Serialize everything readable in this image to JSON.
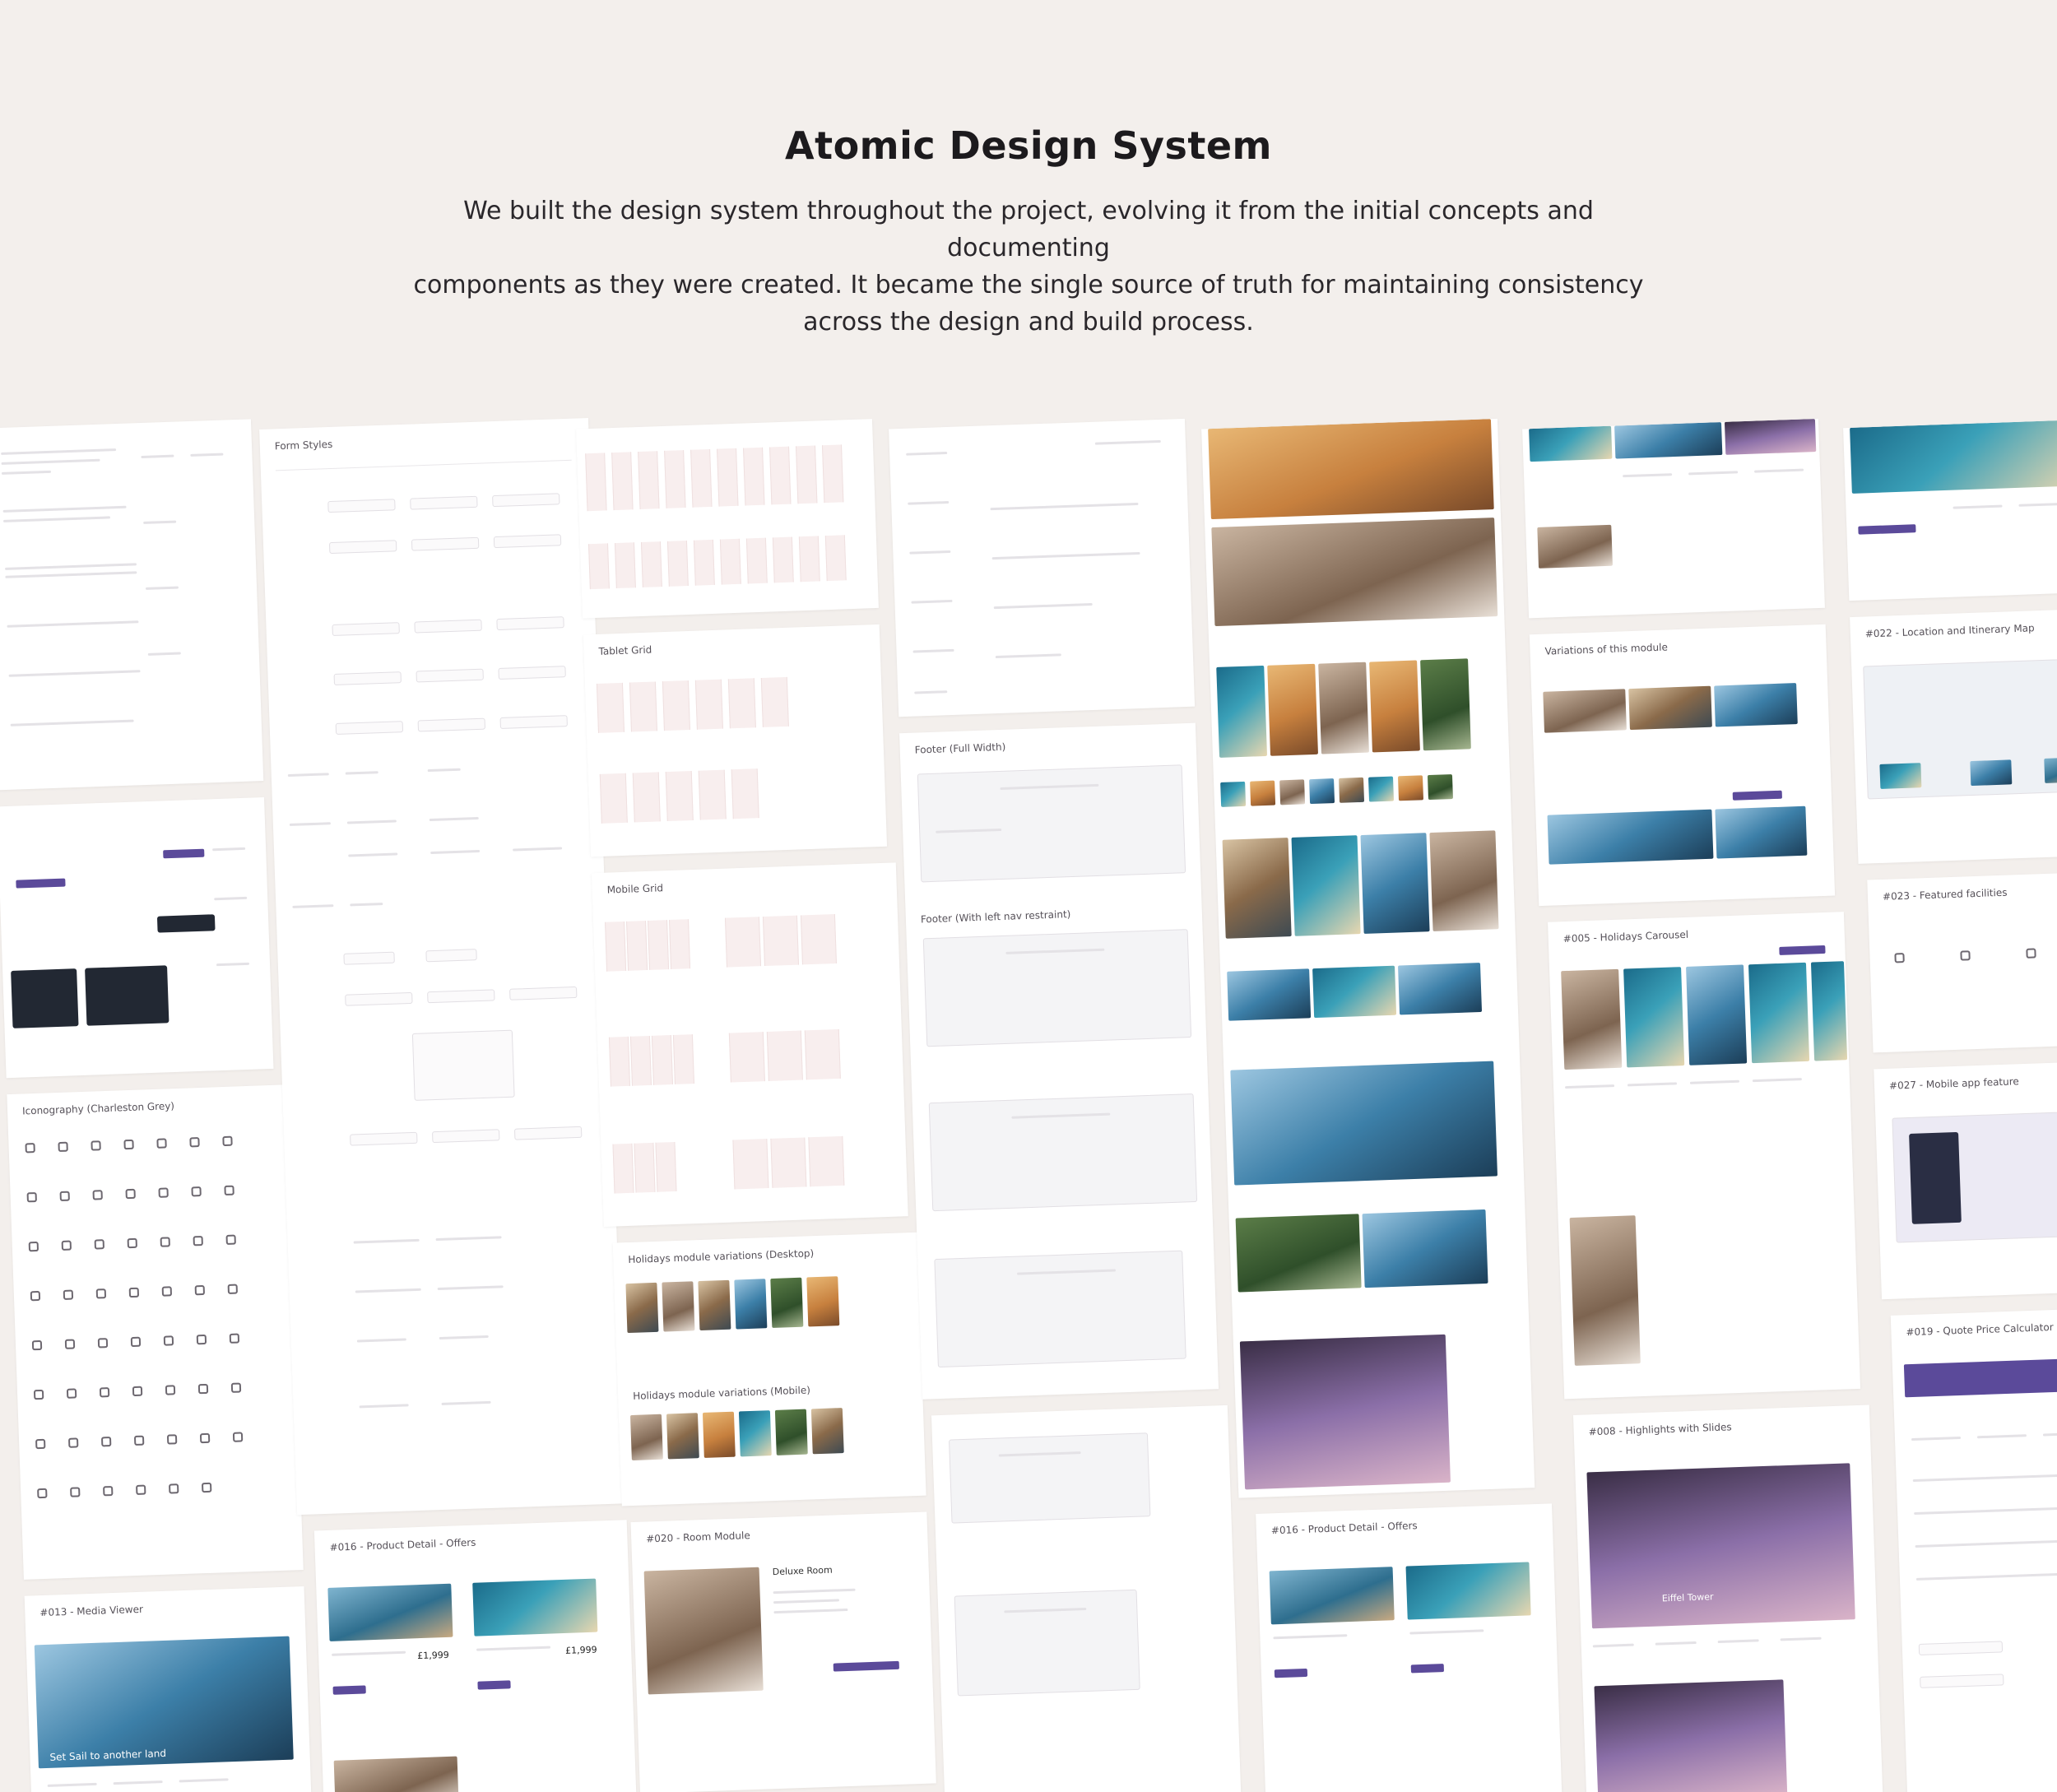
{
  "header": {
    "title": "Atomic Design System",
    "description_lines": [
      "We built the design system throughout the project, evolving it from the initial concepts and documenting",
      "components as they were created. It became the single source of truth for maintaining consistency",
      "across the design and build process."
    ]
  },
  "board": {
    "cards": [
      "Form Styles",
      "Tablet Grid",
      "Mobile Grid",
      "Footer (Full Width)",
      "Footer (With left nav restraint)",
      "Holidays module variations (Desktop)",
      "Holidays module variations (Mobile)",
      "Variations of this module",
      "#005 - Holidays Carousel",
      "#008 - Highlights with Slides",
      "#013 - Media Viewer",
      "#016 - Product Detail - Offers",
      "#020 - Room Module",
      "#022 - Location and Itinerary Map",
      "#023 - Featured facilities",
      "#027 - Mobile app feature",
      "#019 - Quote Price Calculator",
      "Iconography (Charleston Grey)"
    ],
    "image_captions": [
      "Set Sail to another land",
      "Deluxe Room",
      "Eiffel Tower"
    ],
    "prices": [
      "£1,999",
      "£1,999"
    ]
  }
}
